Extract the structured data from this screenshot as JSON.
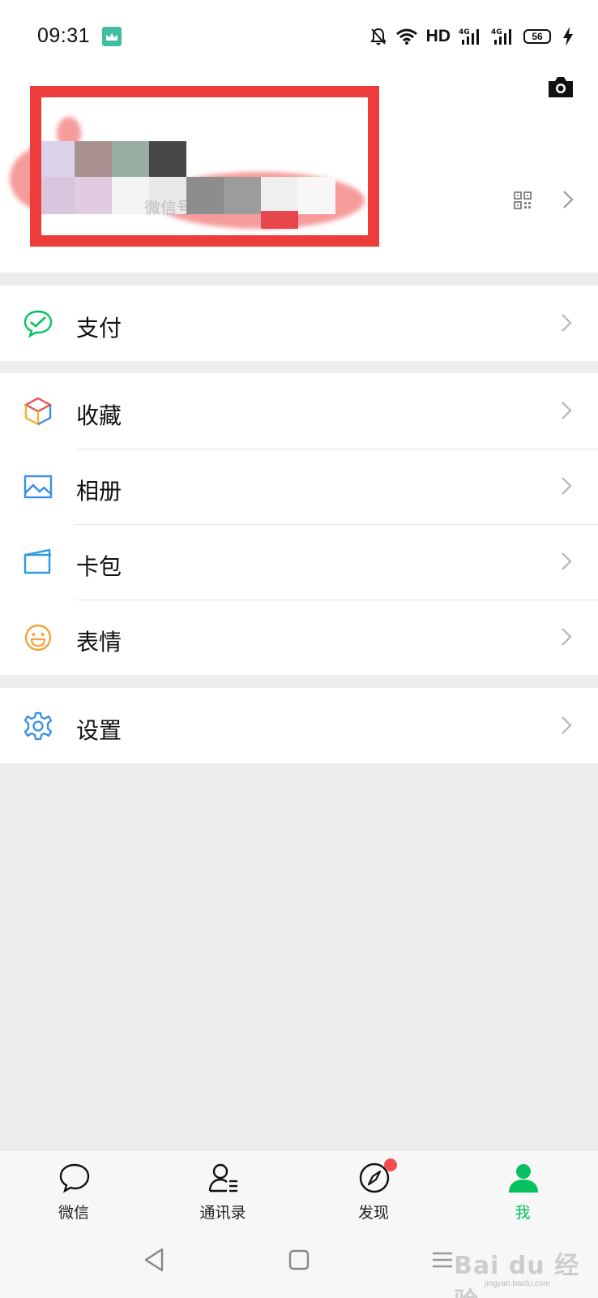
{
  "status_bar": {
    "time": "09:31",
    "network_label": "HD",
    "signal_1": "4G",
    "signal_2": "4G",
    "battery": "56"
  },
  "profile": {
    "wechat_id_label": "微信号"
  },
  "menu": {
    "pay": "支付",
    "favorites": "收藏",
    "album": "相册",
    "cards": "卡包",
    "stickers": "表情",
    "settings": "设置"
  },
  "tabs": [
    {
      "label": "微信",
      "icon": "chat-bubble-icon"
    },
    {
      "label": "通讯录",
      "icon": "contacts-icon"
    },
    {
      "label": "发现",
      "icon": "compass-icon"
    },
    {
      "label": "我",
      "icon": "person-icon"
    }
  ],
  "colors": {
    "accent": "#07c160",
    "annotation_red": "#ee3b3b",
    "badge": "#f24e4e"
  },
  "watermark": {
    "brand": "Bai du 经验",
    "domain": "jingyan.baidu.com"
  }
}
